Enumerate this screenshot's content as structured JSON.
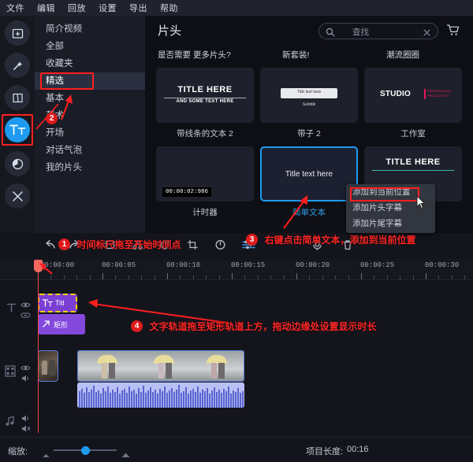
{
  "menubar": {
    "items": [
      {
        "label": "文件"
      },
      {
        "label": "编辑"
      },
      {
        "label": "回放"
      },
      {
        "label": "设置"
      },
      {
        "label": "导出"
      },
      {
        "label": "帮助"
      }
    ]
  },
  "rail": {
    "items": [
      {
        "name": "import-media-icon",
        "label": "导入"
      },
      {
        "name": "magic-wand-icon",
        "label": "特效"
      },
      {
        "name": "transition-icon",
        "label": "转场"
      },
      {
        "name": "text-tt-icon",
        "label": "文字"
      },
      {
        "name": "color-wheel-icon",
        "label": "调色"
      },
      {
        "name": "tools-icon",
        "label": "工具"
      }
    ],
    "selected_index": 3,
    "accent_color": "#1e9bf0",
    "highlight_color": "#ff1f1f"
  },
  "categories": {
    "items": [
      {
        "label": "简介视频"
      },
      {
        "label": "全部"
      },
      {
        "label": "收藏夹"
      },
      {
        "label": "精选"
      },
      {
        "label": "基本"
      },
      {
        "label": "艺术"
      },
      {
        "label": "开场"
      },
      {
        "label": "对话气泡"
      },
      {
        "label": "我的片头"
      }
    ],
    "selected_index": 3
  },
  "browser": {
    "title": "片头",
    "search": {
      "placeholder": "查找",
      "value": ""
    },
    "promos": [
      {
        "label": "是否需要 更多片头?"
      },
      {
        "label": "新套装!"
      },
      {
        "label": "潮流圈圈"
      }
    ],
    "items": [
      {
        "caption": "带线条的文本 2",
        "preview_line1": "TITLE HERE",
        "preview_line2": "AND SOME TEXT HERE",
        "selected": false
      },
      {
        "caption": "带子 2",
        "preview_line1": "Title text here",
        "preview_line2": "Subtitle",
        "selected": false
      },
      {
        "caption": "工作室",
        "preview_line1": "STUDIO",
        "preview_line2": "PROFESSIONAL PRODUCTION",
        "selected": false
      },
      {
        "caption": "计时器",
        "preview_line1": "00:00:02:986",
        "preview_line2": "",
        "selected": false
      },
      {
        "caption": "简单文本",
        "preview_line1": "Title text here",
        "preview_line2": "",
        "selected": true
      },
      {
        "caption": "",
        "preview_line1": "TITLE HERE",
        "preview_line2": "",
        "selected": false
      }
    ]
  },
  "context_menu": {
    "items": [
      {
        "label": "添加到当前位置",
        "highlighted": true
      },
      {
        "label": "添加片头字幕",
        "highlighted": false
      },
      {
        "label": "添加片尾字幕",
        "highlighted": false
      }
    ]
  },
  "timeline": {
    "toolbar": [
      {
        "name": "undo-icon"
      },
      {
        "name": "redo-icon"
      },
      {
        "name": "marker-icon"
      },
      {
        "name": "split-scissors-icon"
      },
      {
        "name": "rotate-icon"
      },
      {
        "name": "crop-icon"
      },
      {
        "name": "speed-icon"
      },
      {
        "name": "audio-mixer-icon"
      },
      {
        "name": "record-voice-icon"
      },
      {
        "name": "delete-icon"
      }
    ],
    "ruler_labels": [
      "00:00:00",
      "00:00:05",
      "00:00:10",
      "00:00:15",
      "00:00:20",
      "00:00:25",
      "00:00:30"
    ],
    "playhead_time": "00:00:00",
    "tracks": [
      {
        "type": "text",
        "head_icon": "text-track-icon",
        "controls": [
          "eye-icon",
          "link-icon"
        ],
        "clips": [
          {
            "label": "Title text here",
            "short_label": "Titl",
            "selected": true
          }
        ]
      },
      {
        "type": "shape",
        "head_icon": "",
        "controls": [],
        "clips": [
          {
            "label": "矩形",
            "short_label": "矩形",
            "selected": false
          }
        ]
      },
      {
        "type": "video",
        "head_icon": "film-strip-icon",
        "controls": [
          "eye-icon",
          "speaker-icon"
        ],
        "clips": [
          {
            "label": "",
            "short_label": "",
            "selected": true
          }
        ]
      },
      {
        "type": "audio",
        "head_icon": "music-note-icon",
        "controls": [
          "speaker-icon",
          "mute-icon"
        ],
        "clips": [
          {
            "label": "",
            "short_label": "",
            "selected": false
          }
        ]
      }
    ]
  },
  "bottombar": {
    "zoom_label": "缩放:",
    "zoom_value": 50,
    "project_length_label": "项目长度:",
    "project_length_value": "00:16"
  },
  "annotations": [
    {
      "num": "1",
      "text": "时间标尺拖至开始时间点"
    },
    {
      "num": "2",
      "text": ""
    },
    {
      "num": "3",
      "text": "右键点击简单文本，添加到当前位置"
    },
    {
      "num": "4",
      "text": "文字轨道拖至矩形轨道上方，拖动边缘处设置显示时长"
    }
  ]
}
